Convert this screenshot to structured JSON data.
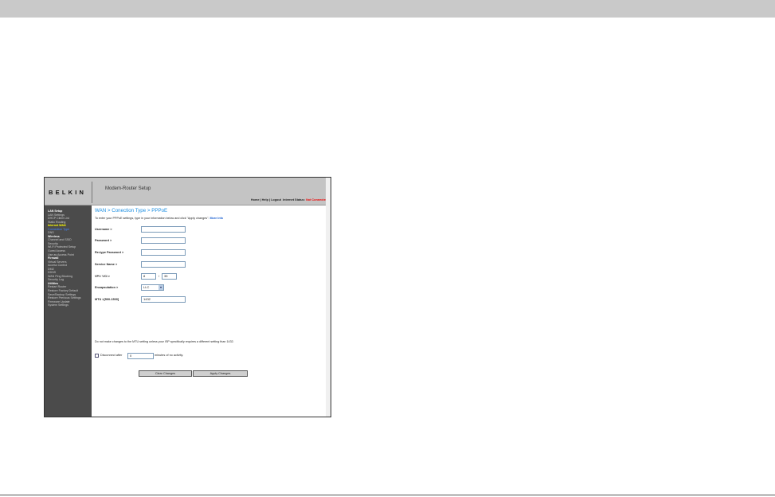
{
  "router": {
    "logo": "BELKIN",
    "app_title": "Modem-Router Setup",
    "top_links": {
      "home": "Home",
      "help": "Help",
      "logout": "Logout",
      "status_label": "Internet Status:",
      "status_value": "Not Connected"
    },
    "sidebar": [
      {
        "label": "LAN Setup",
        "type": "h"
      },
      {
        "label": "LAN Settings"
      },
      {
        "label": "DHCP Client List"
      },
      {
        "label": "Static Routing"
      },
      {
        "label": "Internet WAN",
        "type": "act"
      },
      {
        "label": "Connection Type",
        "type": "sub"
      },
      {
        "label": "DNS"
      },
      {
        "label": "Wireless",
        "type": "h"
      },
      {
        "label": "Channel and SSID"
      },
      {
        "label": "Security"
      },
      {
        "label": "Wi-Fi Protected Setup"
      },
      {
        "label": "Guest Access"
      },
      {
        "label": "Use as Access Point"
      },
      {
        "label": "Firewall",
        "type": "h"
      },
      {
        "label": "Virtual Servers"
      },
      {
        "label": "Access Control"
      },
      {
        "label": "DMZ"
      },
      {
        "label": "DDNS"
      },
      {
        "label": "WAN Ping Blocking"
      },
      {
        "label": "Security Log"
      },
      {
        "label": "Utilities",
        "type": "h"
      },
      {
        "label": "Restart Router"
      },
      {
        "label": "Restore Factory Default"
      },
      {
        "label": "Save/Backup Settings"
      },
      {
        "label": "Restore Previous Settings"
      },
      {
        "label": "Firmware Update"
      },
      {
        "label": "System Settings"
      }
    ],
    "page_title": "WAN > Conection Type > PPPoE",
    "intro": "To enter your PPPoE settings, type in your information below and click \"Apply changes\".",
    "more_info": "More Info",
    "fields": {
      "username": {
        "label": "Username >",
        "value": ""
      },
      "password": {
        "label": "Password >",
        "value": ""
      },
      "retype": {
        "label": "Re-type Password >",
        "value": ""
      },
      "service": {
        "label": "Service Name >",
        "value": ""
      },
      "vpivci": {
        "label": "VPI / VCI >",
        "vpi": "8",
        "sep": "/",
        "vci": "35"
      },
      "encap": {
        "label": "Encapsulation >",
        "value": "LLC"
      },
      "mtu": {
        "label": "MTU >[500-1500]",
        "value": "1432"
      }
    },
    "note": "Do not make changes to the MTU setting unless your ISP specifically requires a different setting than 1432.",
    "disconnect": {
      "before": "Disconnect after",
      "value": "0",
      "after": "minutes of no activity."
    },
    "buttons": {
      "clear": "Clear Changes",
      "apply": "Apply Changes"
    }
  }
}
